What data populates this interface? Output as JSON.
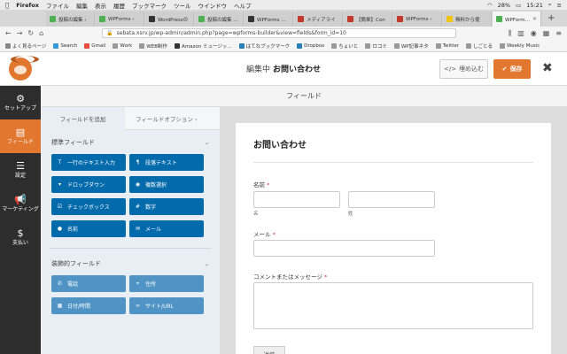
{
  "menubar": {
    "app": "Firefox",
    "items": [
      "ファイル",
      "編集",
      "表示",
      "履歴",
      "ブックマーク",
      "ツール",
      "ウインドウ",
      "ヘルプ"
    ],
    "battery": "28%",
    "clock": "15:21"
  },
  "tabs": [
    {
      "label": "投稿の編集 ‹",
      "color": "#4caf50"
    },
    {
      "label": "WPForms ‹ ",
      "color": "#4caf50"
    },
    {
      "label": "WordPressの",
      "color": "#333"
    },
    {
      "label": "投稿の編集 ‹ テ",
      "color": "#4caf50"
    },
    {
      "label": "WPForms なら",
      "color": "#333"
    },
    {
      "label": "メディアライ",
      "color": "#c0392b"
    },
    {
      "label": "【簡単】Con",
      "color": "#c0392b"
    },
    {
      "label": "WPForms ‹",
      "color": "#c0392b"
    },
    {
      "label": "無料から使",
      "color": "#f1c40f"
    },
    {
      "label": "WPForms ビ",
      "color": "#4caf50",
      "active": true
    }
  ],
  "url": "sebata.xsrv.jp/wp-admin/admin.php?page=wpforms-builder&view=fields&form_id=10",
  "bookmarks": [
    {
      "label": "よく見るページ",
      "color": "#888"
    },
    {
      "label": "Search",
      "color": "#3498db"
    },
    {
      "label": "Gmail",
      "color": "#e74c3c"
    },
    {
      "label": "Work",
      "color": "#999"
    },
    {
      "label": "WEB制作",
      "color": "#999"
    },
    {
      "label": "Amazon ミュージッ...",
      "color": "#333"
    },
    {
      "label": "はてなブックマーク",
      "color": "#2980b9"
    },
    {
      "label": "Dropbox",
      "color": "#2980b9"
    },
    {
      "label": "ちょいと",
      "color": "#999"
    },
    {
      "label": "ロコミ",
      "color": "#999"
    },
    {
      "label": "WP記事ネタ",
      "color": "#999"
    },
    {
      "label": "Twitter",
      "color": "#999"
    },
    {
      "label": "しごとる",
      "color": "#999"
    },
    {
      "label": "Weekly Music",
      "color": "#999"
    }
  ],
  "header": {
    "editing_prefix": "編集中",
    "form_name": "お問い合わせ",
    "embed_label": "埋め込む",
    "save_label": "保存"
  },
  "sidebar": [
    {
      "label": "セットアップ",
      "icon": "⚙",
      "active": false
    },
    {
      "label": "フィールド",
      "icon": "▤",
      "active": true
    },
    {
      "label": "設定",
      "icon": "☰",
      "active": false
    },
    {
      "label": "マーケティング",
      "icon": "📣",
      "active": false
    },
    {
      "label": "支払い",
      "icon": "$",
      "active": false
    }
  ],
  "subheader": "フィールド",
  "panel": {
    "tab_add": "フィールドを追加",
    "tab_options": "フィールドオプション ›",
    "standard_group": "標準フィールド",
    "standard_fields": [
      {
        "label": "一行のテキスト入力",
        "icon": "T"
      },
      {
        "label": "段落テキスト",
        "icon": "¶"
      },
      {
        "label": "ドロップダウン",
        "icon": "▾"
      },
      {
        "label": "複数選択",
        "icon": "◉"
      },
      {
        "label": "チェックボックス",
        "icon": "☑"
      },
      {
        "label": "数字",
        "icon": "#"
      },
      {
        "label": "名前",
        "icon": "👤"
      },
      {
        "label": "メール",
        "icon": "✉"
      }
    ],
    "fancy_group": "装飾的フィールド",
    "fancy_fields": [
      {
        "label": "電話",
        "icon": "✆"
      },
      {
        "label": "住所",
        "icon": "⌖"
      },
      {
        "label": "日付/時間",
        "icon": "▦"
      },
      {
        "label": "サイト/URL",
        "icon": "🔗"
      }
    ]
  },
  "preview": {
    "title": "お問い合わせ",
    "name_label": "名前",
    "first_sub": "名",
    "last_sub": "姓",
    "email_label": "メール",
    "message_label": "コメントまたはメッセージ",
    "submit_label": "送信",
    "required_mark": "*"
  }
}
